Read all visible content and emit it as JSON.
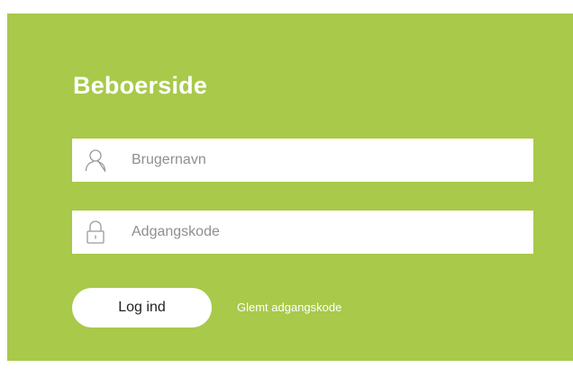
{
  "colors": {
    "panel_background": "#a8c94a",
    "text_white": "#ffffff",
    "icon_gray": "#9a9a9a"
  },
  "login": {
    "title": "Beboerside",
    "username": {
      "value": "",
      "placeholder": "Brugernavn",
      "icon": "user-icon"
    },
    "password": {
      "value": "",
      "placeholder": "Adgangskode",
      "icon": "lock-icon"
    },
    "submit_label": "Log ind",
    "forgot_label": "Glemt adgangskode"
  }
}
